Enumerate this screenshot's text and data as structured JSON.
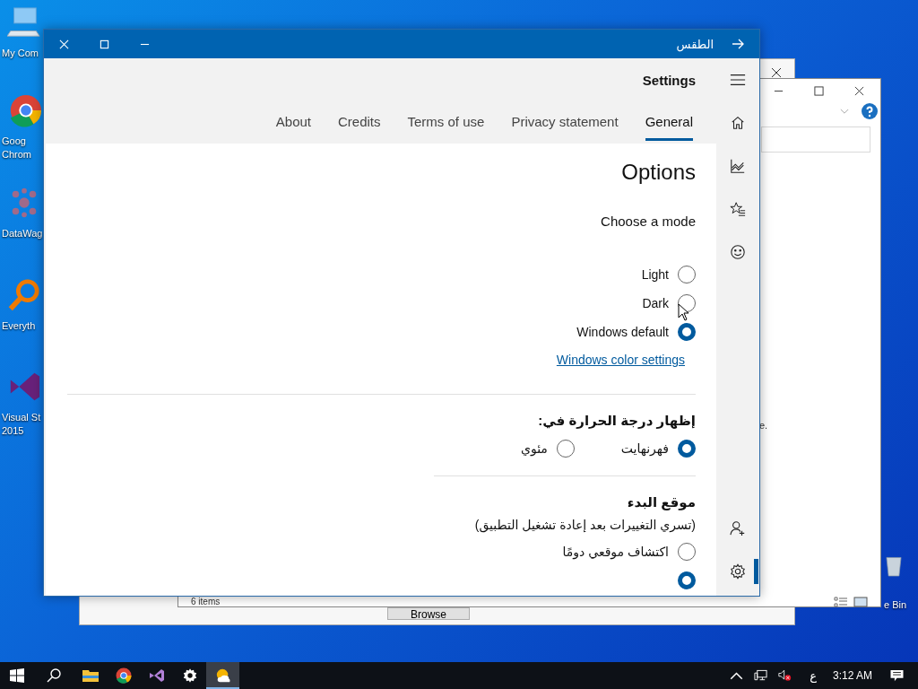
{
  "desktop": {
    "icons": [
      {
        "kind": "computer",
        "lines": [
          "My Com"
        ]
      },
      {
        "kind": "chrome",
        "lines": [
          "Goog",
          "Chrom"
        ]
      },
      {
        "kind": "datawag",
        "lines": [
          "DataWag"
        ]
      },
      {
        "kind": "everything",
        "lines": [
          "Everyth"
        ]
      },
      {
        "kind": "studio",
        "lines": [
          "Visual St",
          "2015"
        ]
      }
    ],
    "recycle_bin": {
      "label": "e Bin"
    }
  },
  "background_windows": {
    "explorer": {
      "status": "6 items",
      "fragment": "e."
    },
    "dialog": {
      "button": "Browse"
    }
  },
  "window": {
    "title": "الطقس",
    "header": "Settings",
    "tabs": [
      {
        "label": "About",
        "selected": false
      },
      {
        "label": "Credits",
        "selected": false
      },
      {
        "label": "Terms of use",
        "selected": false
      },
      {
        "label": "Privacy statement",
        "selected": false
      },
      {
        "label": "General",
        "selected": true
      }
    ],
    "options": {
      "heading": "Options",
      "mode_label": "Choose a mode",
      "modes": [
        {
          "label": "Light",
          "selected": false
        },
        {
          "label": "Dark",
          "selected": false
        },
        {
          "label": "Windows default",
          "selected": true
        }
      ],
      "link": "Windows color settings"
    },
    "temperature": {
      "heading": "إظهار درجة الحرارة في:",
      "units": [
        {
          "label": "فهرنهايت",
          "selected": true
        },
        {
          "label": "مئوي",
          "selected": false
        }
      ]
    },
    "launch": {
      "heading": "موقع البدء",
      "note": "(تسري التغييرات بعد إعادة تشغيل التطبيق)",
      "choices": [
        {
          "label": "اكتشاف موقعي دومًا",
          "selected": false
        },
        {
          "selected": true
        }
      ]
    },
    "rail_top": [
      {
        "kind": "menu",
        "selected": false
      },
      {
        "kind": "home",
        "selected": false
      },
      {
        "kind": "chart",
        "selected": false
      },
      {
        "kind": "favorites",
        "selected": false
      },
      {
        "kind": "smiley",
        "selected": false
      }
    ],
    "rail_bottom": [
      {
        "kind": "add-person",
        "selected": false
      },
      {
        "kind": "settings",
        "selected": true
      }
    ]
  },
  "taskbar": {
    "apps": [
      {
        "kind": "explorer",
        "active": false
      },
      {
        "kind": "chrome",
        "active": false
      },
      {
        "kind": "studio",
        "active": false
      },
      {
        "kind": "settings",
        "active": false
      },
      {
        "kind": "weather",
        "active": true
      }
    ],
    "language": "ع",
    "time": "3:12 AM"
  }
}
